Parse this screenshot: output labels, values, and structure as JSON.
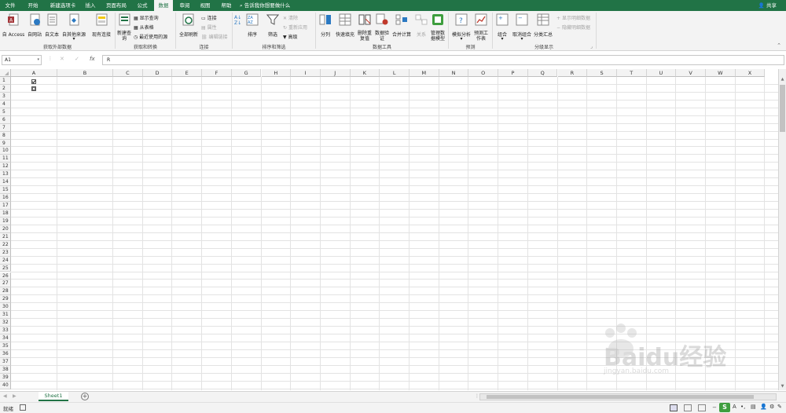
{
  "tabs": [
    "文件",
    "开始",
    "新建选项卡",
    "插入",
    "页面布局",
    "公式",
    "数据",
    "审阅",
    "视图",
    "帮助"
  ],
  "active_tab": "数据",
  "tell_me": "告诉我你想要做什么",
  "share": "共享",
  "ribbon": {
    "ext": [
      "自 Access",
      "自网站",
      "自文本",
      "自其他来源",
      "现有连接"
    ],
    "ext_label": "获取外部数据",
    "newquery": "新建查询",
    "get_small": [
      "显示查询",
      "从表格",
      "最近使用的源"
    ],
    "get_label": "获取和转换",
    "refresh": "全部刷新",
    "conn_small": [
      "连接",
      "属性",
      "编辑链接"
    ],
    "conn_label": "连接",
    "sort": "排序",
    "filter": "筛选",
    "sort_small": [
      "清除",
      "重新应用",
      "高级"
    ],
    "sort_label": "排序和筛选",
    "tools": [
      "分列",
      "快速填充",
      "删除重复值",
      "数据验证",
      "合并计算",
      "关系",
      "管理数据模型"
    ],
    "tools_label": "数据工具",
    "forecast": [
      "模拟分析",
      "预测工作表"
    ],
    "forecast_label": "预测",
    "outline": [
      "组合",
      "取消组合",
      "分类汇总"
    ],
    "outline_small": [
      "显示明细数据",
      "隐藏明细数据"
    ],
    "outline_label": "分级显示"
  },
  "formula": {
    "namebox": "A1",
    "fx": "fx",
    "content": "R"
  },
  "columns": [
    "A",
    "B",
    "C",
    "D",
    "E",
    "F",
    "G",
    "H",
    "I",
    "J",
    "K",
    "L",
    "M",
    "N",
    "O",
    "P",
    "Q",
    "R",
    "S",
    "T",
    "U",
    "V",
    "W",
    "X"
  ],
  "rows": [
    "1",
    "2",
    "3",
    "4",
    "5",
    "6",
    "7",
    "8",
    "9",
    "10",
    "11",
    "12",
    "13",
    "14",
    "15",
    "16",
    "17",
    "18",
    "19",
    "20",
    "21",
    "22",
    "23",
    "24",
    "25",
    "26",
    "27",
    "28",
    "29",
    "30",
    "31",
    "32",
    "33",
    "34",
    "35",
    "36",
    "37",
    "38",
    "39",
    "40"
  ],
  "sheet_tab": "Sheet1",
  "status": "就绪",
  "watermark": "Baidu经验",
  "watermark_url": "jingyan.baidu.com",
  "colors": {
    "accent": "#217346",
    "ribbon": "#f3f3f3"
  }
}
